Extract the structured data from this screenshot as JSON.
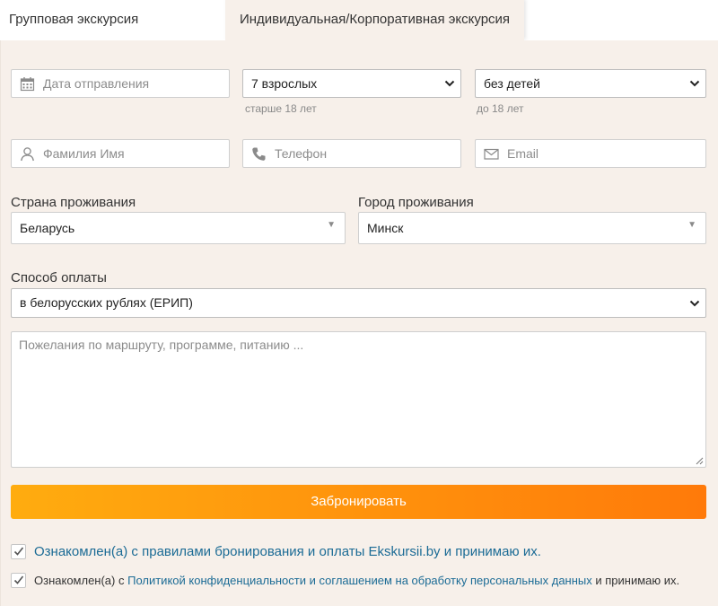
{
  "tabs": {
    "group": "Групповая экскурсия",
    "individual": "Индивидуальная/Корпоративная экскурсия"
  },
  "form": {
    "date_placeholder": "Дата отправления",
    "adults_value": "7 взрослых",
    "adults_hint": "старше 18 лет",
    "children_value": "без детей",
    "children_hint": "до 18 лет",
    "name_placeholder": "Фамилия Имя",
    "phone_placeholder": "Телефон",
    "email_placeholder": "Email",
    "country_label": "Страна проживания",
    "country_value": "Беларусь",
    "city_label": "Город проживания",
    "city_value": "Минск",
    "payment_label": "Способ оплаты",
    "payment_value": "в белорусских рублях (ЕРИП)",
    "wishes_placeholder": "Пожелания по маршруту, программе, питанию ...",
    "submit_label": "Забронировать"
  },
  "agreements": {
    "first_link": "Ознакомлен(а) с правилами бронирования и оплаты Ekskursii.by и принимаю их.",
    "second_prefix": "Ознакомлен(а) с ",
    "second_link": "Политикой конфиденциальности и соглашением на обработку персональных данных",
    "second_suffix": " и принимаю их."
  },
  "colors": {
    "panel_bg": "#f7f0ea",
    "button_start": "#ffac0f",
    "button_end": "#ff7a0a",
    "link": "#1b6b95"
  },
  "icons": [
    "calendar-icon",
    "user-icon",
    "phone-icon",
    "envelope-icon",
    "chevron-down-icon",
    "check-icon"
  ]
}
